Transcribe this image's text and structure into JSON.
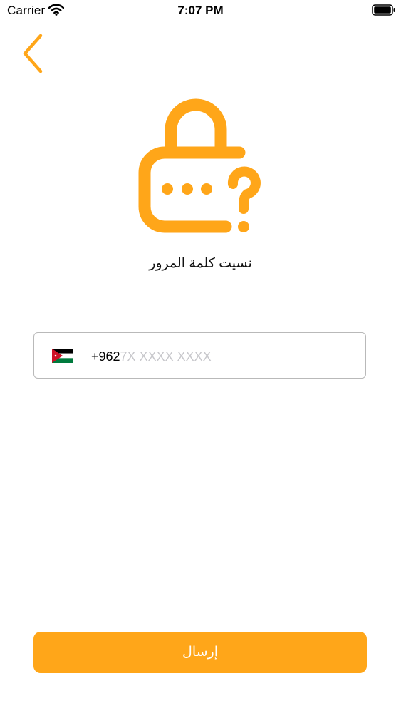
{
  "status_bar": {
    "carrier": "Carrier",
    "time": "7:07 PM",
    "wifi_icon": "wifi-icon",
    "battery_icon": "battery-icon"
  },
  "header": {
    "back_icon": "chevron-left-icon"
  },
  "hero": {
    "icon": "lock-question-icon",
    "title": "نسيت كلمة المرور"
  },
  "phone_input": {
    "flag_icon": "jordan-flag-icon",
    "dial_code": "+962",
    "placeholder": "7X XXXX XXXX"
  },
  "submit": {
    "label": "إرسال"
  },
  "colors": {
    "accent": "#FFA619",
    "field_border": "#b9b9b9",
    "placeholder": "#c8c8cc"
  }
}
